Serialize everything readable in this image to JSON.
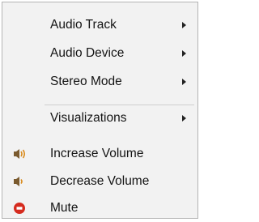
{
  "menu": {
    "items": [
      {
        "label": "Audio Track",
        "submenu": true
      },
      {
        "label": "Audio Device",
        "submenu": true
      },
      {
        "label": "Stereo Mode",
        "submenu": true
      },
      {
        "label": "Visualizations",
        "submenu": true
      },
      {
        "label": "Increase Volume",
        "icon": "volume-up-icon"
      },
      {
        "label": "Decrease Volume",
        "icon": "volume-down-icon"
      },
      {
        "label": "Mute",
        "icon": "mute-icon"
      }
    ]
  },
  "colors": {
    "menu_background": "#f2f2f2",
    "speaker_brown": "#7a5a2e",
    "sound_wave_orange": "#d98a1a",
    "mute_red": "#d52b1e"
  }
}
